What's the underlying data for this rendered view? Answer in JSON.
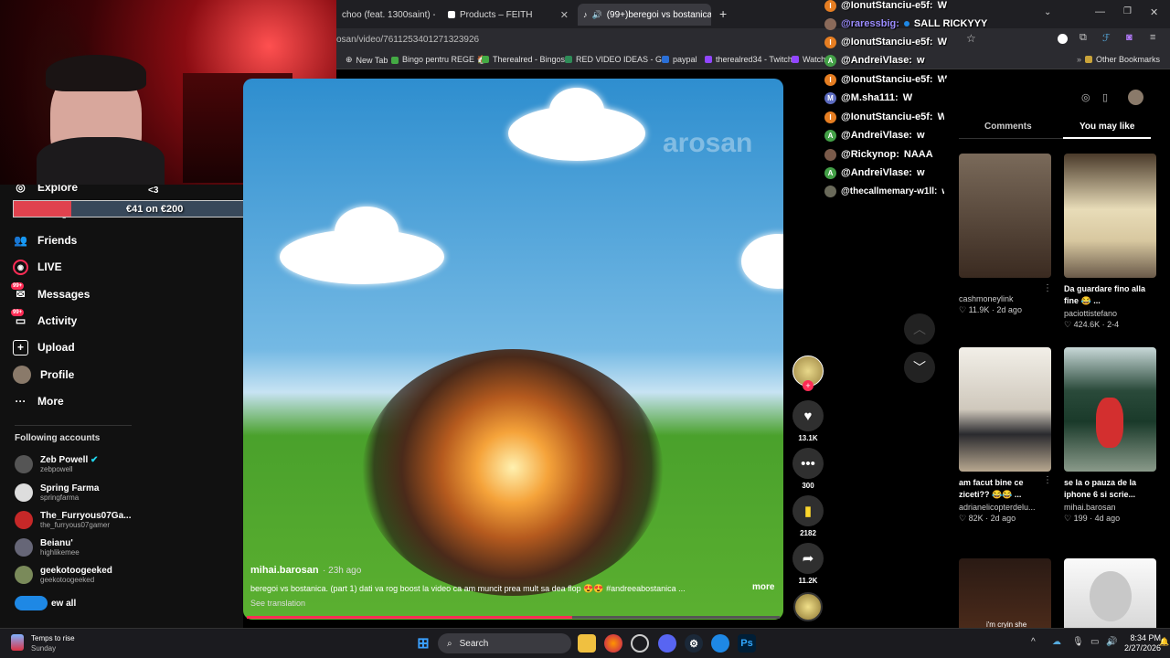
{
  "browser": {
    "tabs": [
      {
        "label": "choo (feat. 1300saint) - You"
      },
      {
        "label": "Products – FEITH"
      },
      {
        "label": "(99+)beregoi vs bostanica"
      }
    ],
    "url": "osan/video/7611253401271323926",
    "bookmarks": [
      "New Tab",
      "Bingo pentru REGE 🏠",
      "Therealred - Bingos",
      "RED VIDEO IDEAS - G...",
      "paypal",
      "therealred34 - Twitch",
      "Watch"
    ],
    "other_bookmarks": "Other Bookmarks"
  },
  "overlay": {
    "donation_text": "€41 on €200",
    "donation_progress": 0.205,
    "heart_counter": "<3"
  },
  "chat": [
    {
      "user": "@IonutStanciu-e5f:",
      "msg": "W",
      "icon": "I",
      "color": "#e67e22"
    },
    {
      "user": "@raressbig:",
      "msg": "SALL RICKYYY",
      "icon": "",
      "color": "#8a6a5a",
      "userColor": "#9b8cff"
    },
    {
      "user": "@IonutStanciu-e5f:",
      "msg": "W",
      "icon": "I",
      "color": "#e67e22"
    },
    {
      "user": "@AndreiVlase:",
      "msg": "w",
      "icon": "A",
      "color": "#43a047"
    },
    {
      "user": "@IonutStanciu-e5f:",
      "msg": "W",
      "icon": "I",
      "color": "#e67e22"
    },
    {
      "user": "@M.sha111:",
      "msg": "W",
      "icon": "M",
      "color": "#5c6bc0"
    },
    {
      "user": "@IonutStanciu-e5f:",
      "msg": "W",
      "icon": "I",
      "color": "#e67e22"
    },
    {
      "user": "@AndreiVlase:",
      "msg": "w",
      "icon": "A",
      "color": "#43a047"
    },
    {
      "user": "@Rickynop:",
      "msg": "NAAA",
      "icon": "",
      "color": "#7a5a4a"
    },
    {
      "user": "@AndreiVlase:",
      "msg": "w",
      "icon": "A",
      "color": "#43a047"
    },
    {
      "user": "@thecallmemary-w1ll:",
      "msg": "w",
      "icon": "",
      "color": "#6a6a5a"
    }
  ],
  "sidebar": {
    "explore": "Explore",
    "following_partial": "ng",
    "items": [
      {
        "label": "Friends",
        "icon": "friends-icon"
      },
      {
        "label": "LIVE",
        "icon": "live-icon"
      },
      {
        "label": "Messages",
        "icon": "messages-icon",
        "badge": "99+"
      },
      {
        "label": "Activity",
        "icon": "activity-icon",
        "badge": "99+"
      },
      {
        "label": "Upload",
        "icon": "upload-icon"
      },
      {
        "label": "Profile",
        "icon": "profile-icon"
      },
      {
        "label": "More",
        "icon": "more-icon"
      }
    ],
    "following_header": "Following accounts",
    "accounts": [
      {
        "name": "Zeb Powell",
        "handle": "zebpowell",
        "verified": true,
        "color": "#555"
      },
      {
        "name": "Spring Farma",
        "handle": "springfarma",
        "verified": false,
        "color": "#ddd"
      },
      {
        "name": "The_Furryous07Ga...",
        "handle": "the_furryous07gamer",
        "verified": false,
        "color": "#c62828"
      },
      {
        "name": "Beianu'",
        "handle": "highlikemee",
        "verified": false,
        "color": "#667"
      },
      {
        "name": "geekotoogeeked",
        "handle": "geekotoogeeked",
        "verified": false,
        "color": "#7a8a5a"
      }
    ],
    "view_all": "ew all"
  },
  "video": {
    "watermark": "arosan",
    "author": "mihai.barosan",
    "time": "· 23h ago",
    "caption": "beregoi vs bostanica. (part 1) dati va rog boost la video ca am muncit prea mult sa dea flop 😍😍 #andreeabostanica ...",
    "more": "more",
    "see_translation": "See translation",
    "progress": 0.61
  },
  "actions": {
    "likes": "13.1K",
    "comments": "300",
    "saves": "2182",
    "shares": "11.2K"
  },
  "right_panel": {
    "tabs": [
      "Comments",
      "You may like"
    ],
    "cards": [
      {
        "title": "",
        "user": "cashmoneylink",
        "stats": "♡ 11.9K · 2d ago"
      },
      {
        "title": "Da guardare fino alla fine 😂 ...",
        "user": "paciottistefano",
        "stats": "♡ 424.6K · 2-4"
      },
      {
        "title": "am facut bine ce ziceti?? 😂😂 ...",
        "user": "adrianelicopterdelu...",
        "stats": "♡ 82K · 2d ago"
      },
      {
        "title": "se la o pauza de la iphone 6 si scrie...",
        "user": "mihai.barosan",
        "stats": "♡ 199 · 4d ago"
      }
    ],
    "bottom_thumb_text": "i'm cryin she"
  },
  "taskbar": {
    "weather_title": "Temps to rise",
    "weather_sub": "Sunday",
    "search": "Search",
    "time": "8:34 PM",
    "date": "2/27/2026"
  }
}
